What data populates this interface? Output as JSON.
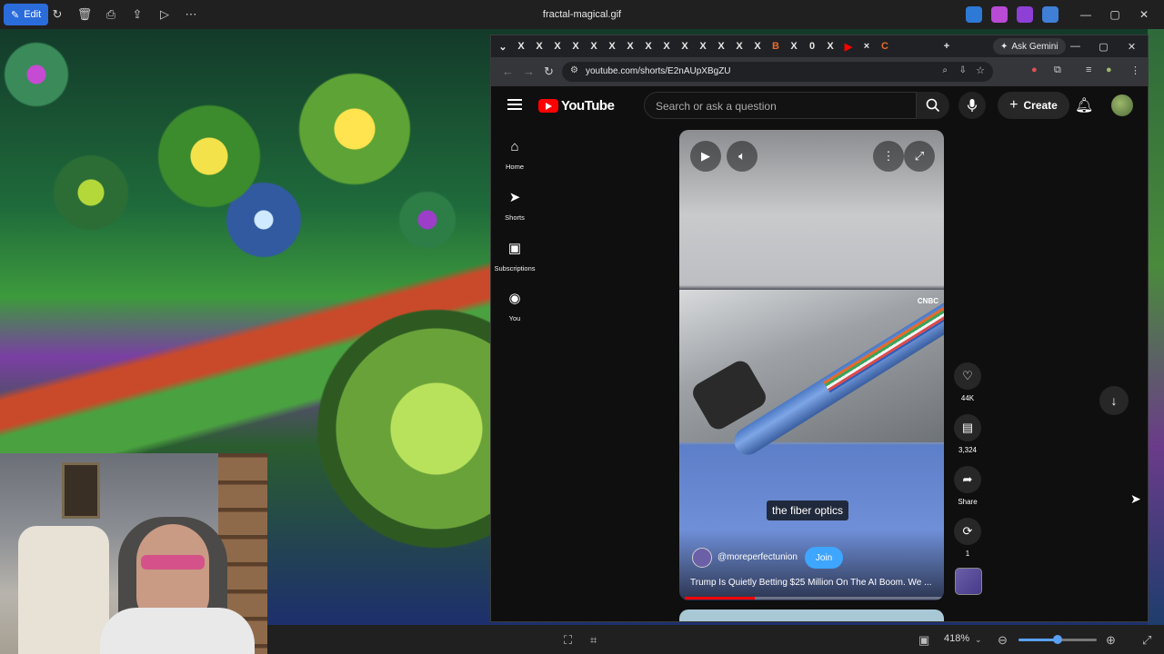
{
  "viewer": {
    "edit_label": "Edit",
    "file_title": "fractal-magical.gif",
    "zoom": "418%",
    "zoom_level": 0.5
  },
  "browser": {
    "ask_gemini": "Ask Gemini",
    "url": "youtube.com/shorts/E2nAUpXBgZU",
    "tab_favicons": [
      "X",
      "X",
      "X",
      "X",
      "X",
      "X",
      "X",
      "X",
      "X",
      "X",
      "X",
      "X",
      "X",
      "X",
      "B",
      "X",
      "0",
      "X",
      "▶",
      "×",
      "C"
    ]
  },
  "youtube": {
    "logo_text": "YouTube",
    "search_placeholder": "Search or ask a question",
    "create_label": "Create",
    "guide": [
      {
        "label": "Home",
        "icon": "home-icon"
      },
      {
        "label": "Shorts",
        "icon": "shorts-icon"
      },
      {
        "label": "Subscriptions",
        "icon": "subscriptions-icon"
      },
      {
        "label": "You",
        "icon": "you-icon"
      }
    ]
  },
  "short": {
    "watermark": "CNBC",
    "caption": "the fiber optics",
    "channel": "@moreperfectunion",
    "join_label": "Join",
    "title": "Trump Is Quietly Betting $25 Million On The AI Boom. We ...",
    "progress": 0.27,
    "likes": "44K",
    "comments": "3,324",
    "share_label": "Share",
    "remix_count": "1"
  },
  "colors": {
    "youtube_red": "#ff0000",
    "join_blue": "#3ea6ff",
    "edit_blue": "#2b6cdb"
  }
}
